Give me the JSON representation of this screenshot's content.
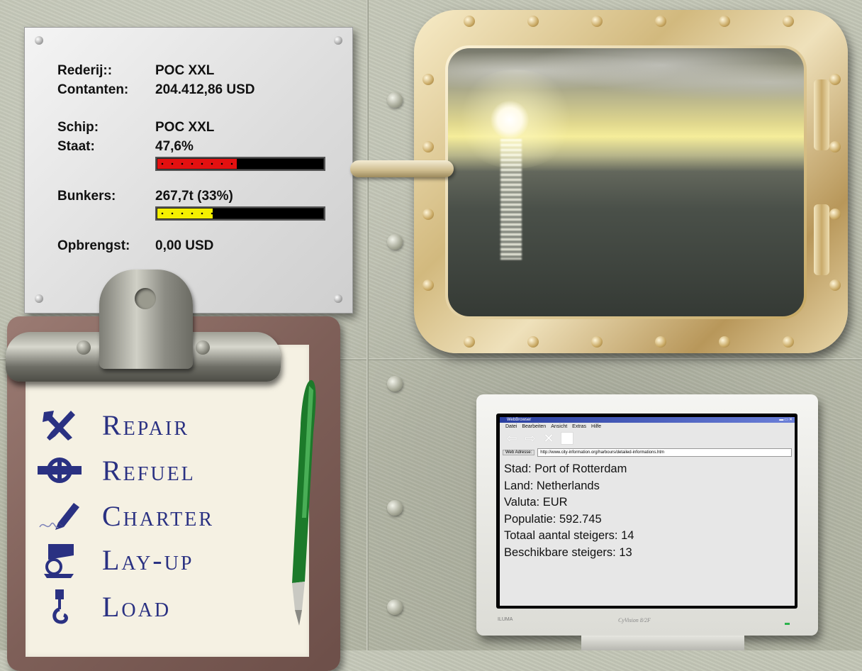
{
  "status": {
    "company_label": "Rederij::",
    "company_value": "POC XXL",
    "cash_label": "Contanten:",
    "cash_value": "204.412,86 USD",
    "ship_label": "Schip:",
    "ship_value": "POC XXL",
    "state_label": "Staat:",
    "state_value": "47,6%",
    "state_level": 0.476,
    "bunkers_label": "Bunkers:",
    "bunkers_value": "267,7t (33%)",
    "bunkers_level": 0.33,
    "revenue_label": "Opbrengst:",
    "revenue_value": "0,00 USD"
  },
  "menu": {
    "items": [
      {
        "label": "Repair",
        "icon": "wrench-screwdriver-icon"
      },
      {
        "label": "Refuel",
        "icon": "fuel-valve-icon"
      },
      {
        "label": "Charter",
        "icon": "fountain-pen-icon"
      },
      {
        "label": "Lay-up",
        "icon": "anchor-flag-icon"
      },
      {
        "label": "Load",
        "icon": "crane-hook-icon"
      }
    ]
  },
  "browser": {
    "title": "WebBrowser",
    "menu": [
      "Datei",
      "Bearbeiten",
      "Ansicht",
      "Extras",
      "Hilfe"
    ],
    "address_label": "Web Adresse:",
    "address": "http://www.city-information.org/harbours/detailed-informations.htm",
    "lines": [
      "Stad: Port of Rotterdam",
      "Land: Netherlands",
      "Valuta: EUR",
      "Populatie: 592.745",
      "Totaal aantal steigers: 14",
      "Beschikbare steigers: 13"
    ]
  },
  "monitor": {
    "brand": "ILUMA",
    "model": "CyVision 8/2F"
  },
  "colors": {
    "menu_text": "#2a3182",
    "state_fill": "#e41010",
    "bunkers_fill": "#f5f000"
  }
}
